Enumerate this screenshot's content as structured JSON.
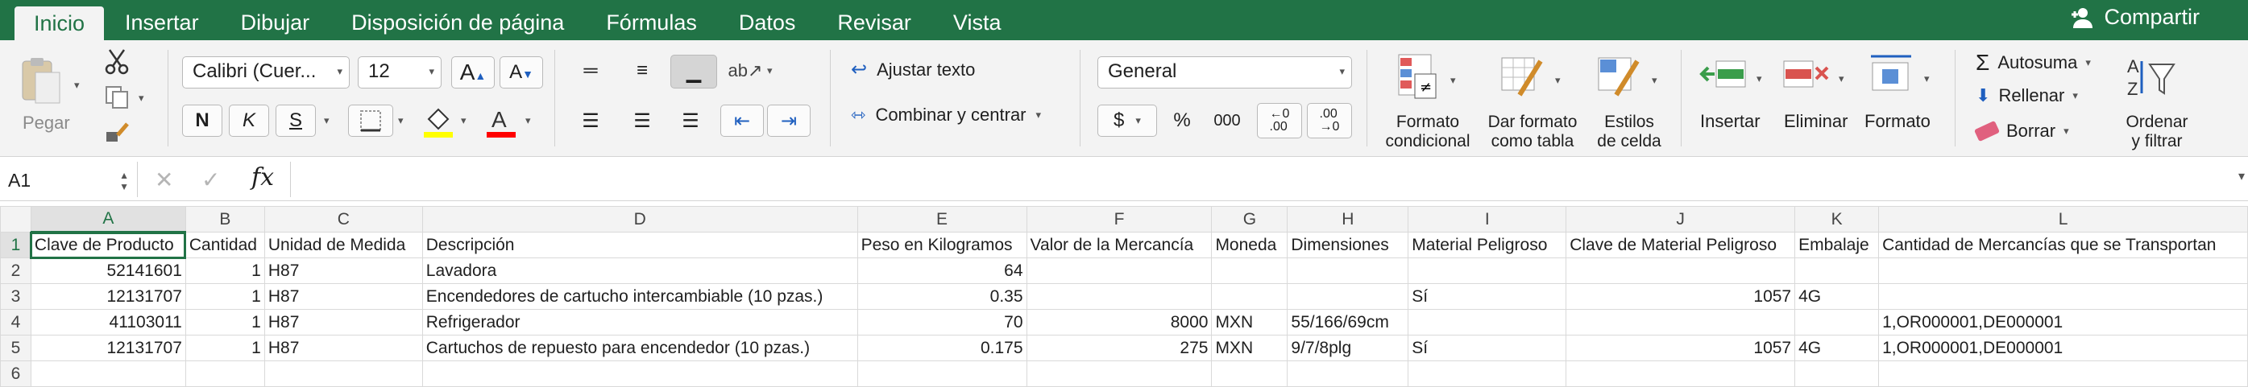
{
  "ribbon": {
    "tabs": [
      "Inicio",
      "Insertar",
      "Dibujar",
      "Disposición de página",
      "Fórmulas",
      "Datos",
      "Revisar",
      "Vista"
    ],
    "share_label": "Compartir"
  },
  "toolbar": {
    "paste_label": "Pegar",
    "font_name": "Calibri (Cuer...",
    "font_size": "12",
    "bold": "N",
    "italic": "K",
    "underline": "S",
    "wrap_text": "Ajustar texto",
    "merge_center": "Combinar y centrar",
    "number_format": "General",
    "currency": "$",
    "percent": "%",
    "thousands": "000",
    "cond_format": [
      "Formato",
      "condicional"
    ],
    "table_format": [
      "Dar formato",
      "como tabla"
    ],
    "cell_styles": [
      "Estilos",
      "de celda"
    ],
    "insert": "Insertar",
    "delete": "Eliminar",
    "format": "Formato",
    "autosum": "Autosuma",
    "fill": "Rellenar",
    "clear": "Borrar",
    "sort_filter": [
      "Ordenar",
      "y filtrar"
    ],
    "fill_color": "#ffff00",
    "font_color": "#ff0000"
  },
  "formula_bar": {
    "name_box": "A1",
    "fx": "fx",
    "value": ""
  },
  "sheet": {
    "columns": [
      "A",
      "B",
      "C",
      "D",
      "E",
      "F",
      "G",
      "H",
      "I",
      "J",
      "K",
      "L"
    ],
    "rows": [
      {
        "n": "1",
        "cells": [
          "Clave de Producto",
          "Cantidad",
          "Unidad de Medida",
          "Descripción",
          "Peso en Kilogramos",
          "Valor de la Mercancía",
          "Moneda",
          "Dimensiones",
          "Material Peligroso",
          "Clave de Material Peligroso",
          "Embalaje",
          "Cantidad de Mercancías que se Transportan"
        ]
      },
      {
        "n": "2",
        "cells": [
          "52141601",
          "1",
          "H87",
          "Lavadora",
          "64",
          "",
          "",
          "",
          "",
          "",
          "",
          ""
        ]
      },
      {
        "n": "3",
        "cells": [
          "12131707",
          "1",
          "H87",
          "Encendedores de cartucho intercambiable (10 pzas.)",
          "0.35",
          "",
          "",
          "",
          "Sí",
          "1057",
          "4G",
          ""
        ]
      },
      {
        "n": "4",
        "cells": [
          "41103011",
          "1",
          "H87",
          "Refrigerador",
          "70",
          "8000",
          "MXN",
          "55/166/69cm",
          "",
          "",
          "",
          "1,OR000001,DE000001"
        ]
      },
      {
        "n": "5",
        "cells": [
          "12131707",
          "1",
          "H87",
          "Cartuchos de repuesto para encendedor (10 pzas.)",
          "0.175",
          "275",
          "MXN",
          "9/7/8plg",
          "Sí",
          "1057",
          "4G",
          "1,OR000001,DE000001"
        ]
      },
      {
        "n": "6",
        "cells": [
          "",
          "",
          "",
          "",
          "",
          "",
          "",
          "",
          "",
          "",
          "",
          ""
        ]
      }
    ]
  }
}
